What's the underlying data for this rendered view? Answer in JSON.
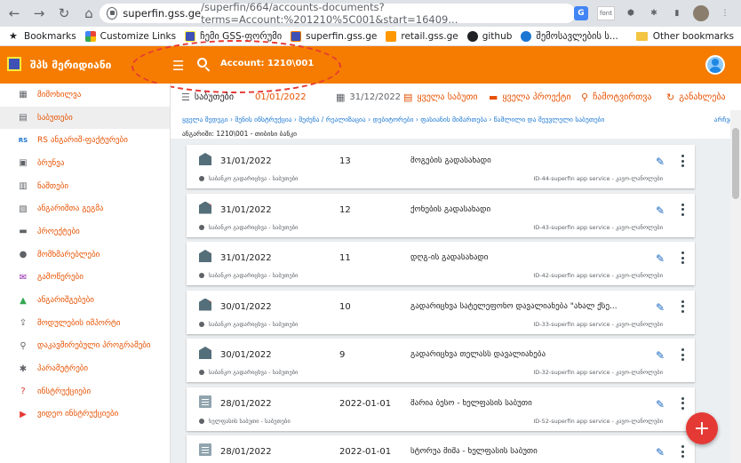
{
  "browser": {
    "url_host": "superfin.gss.ge",
    "url_path": "/superfin/664/accounts-documents?terms=Account:%201210%5C001&start=16409...",
    "ext_font_label": "font",
    "bookmarks": [
      {
        "label": "Bookmarks",
        "icon": "star-icon"
      },
      {
        "label": "Customize Links",
        "icon": "apps-icon"
      },
      {
        "label": "ჩემი GSS-ფორუმი",
        "icon": "gss-icon"
      },
      {
        "label": "superfin.gss.ge",
        "icon": "superfin-icon"
      },
      {
        "label": "retail.gss.ge",
        "icon": "cart-icon"
      },
      {
        "label": "github",
        "icon": "github-icon"
      },
      {
        "label": "შემოსავლების ს...",
        "icon": "revenue-icon"
      }
    ],
    "other_bookmarks": "Other bookmarks"
  },
  "header": {
    "app_name": "შპს მერიდიანი",
    "search_text": "Account: 1210\\001"
  },
  "sidebar": {
    "items": [
      {
        "label": "მიმოხილვა",
        "icon": "grid-icon",
        "active": false
      },
      {
        "label": "საბუთები",
        "icon": "document-icon",
        "active": true
      },
      {
        "label": "RS ანგარიშ-ფაქტურები",
        "icon": "rs-icon",
        "active": false
      },
      {
        "label": "ბრუნვა",
        "icon": "turnover-icon",
        "active": false
      },
      {
        "label": "ნაშთები",
        "icon": "balance-icon",
        "active": false
      },
      {
        "label": "ანგარიშთა გეგმა",
        "icon": "chart-plan-icon",
        "active": false
      },
      {
        "label": "პროექტები",
        "icon": "folder-icon",
        "active": false
      },
      {
        "label": "მომხმარებლები",
        "icon": "users-icon",
        "active": false
      },
      {
        "label": "გამოწერები",
        "icon": "subscription-icon",
        "active": false
      },
      {
        "label": "ანგარიშგებები",
        "icon": "drive-icon",
        "active": false
      },
      {
        "label": "მოდულების იმპორტი",
        "icon": "import-icon",
        "active": false
      },
      {
        "label": "დაკავშირებული პროგრამები",
        "icon": "attach-icon",
        "active": false
      },
      {
        "label": "პარამეტრები",
        "icon": "settings-icon",
        "active": false
      },
      {
        "label": "ინსტრუქციები",
        "icon": "help-icon",
        "active": false
      },
      {
        "label": "ვიდეო ინსტრუქციები",
        "icon": "video-icon",
        "active": false
      }
    ]
  },
  "toolbar": {
    "title": "საბუთები",
    "date_from": "01/01/2022",
    "date_to": "31/12/2022",
    "all_docs": "ყველა საბუთი",
    "all_projects": "ყველა პროექტი",
    "attach": "ჩამოტვირთვა",
    "refresh": "განახლება"
  },
  "breadcrumb": {
    "path": "ყველა შედეგი  ›  მენის ინსტრუქცია  ›  შეძენა / რეალიზაცია  ›  დებიტორები  ›  ფასიანის მიმართება  ›  წამლილი და შეუვლელი საბუთები",
    "end": "არჩვა",
    "subline": "ანგარიში: 1210\\001 - თიბისი ბანკი"
  },
  "documents": [
    {
      "date": "31/01/2022",
      "num": "13",
      "desc": "მოგების გადასახადი",
      "sub": "საბანკო გადარიცხვა - საბუთები",
      "id": "ID-44-superfin app service - კავო-ლანოლები",
      "icon": "bank-icon"
    },
    {
      "date": "31/01/2022",
      "num": "12",
      "desc": "ქონების გადასახადი",
      "sub": "საბანკო გადარიცხვა - საბუთები",
      "id": "ID-43-superfin app service - კავო-ლანოლები",
      "icon": "bank-icon"
    },
    {
      "date": "31/01/2022",
      "num": "11",
      "desc": "დღგ-ის გადასახადი",
      "sub": "საბანკო გადარიცხვა - საბუთები",
      "id": "ID-42-superfin app service - კავო-ლანოლები",
      "icon": "bank-icon"
    },
    {
      "date": "30/01/2022",
      "num": "10",
      "desc": "გადარიცხვა სატელეფონო დავალიანება \"ახალ ქსე...",
      "sub": "საბანკო გადარიცხვა - საბუთები",
      "id": "ID-33-superfin app service - კავო-ლანოლები",
      "icon": "bank-icon"
    },
    {
      "date": "30/01/2022",
      "num": "9",
      "desc": "გადარიცხვა თელასს დავალიანება",
      "sub": "საბანკო გადარიცხვა - საბუთები",
      "id": "ID-32-superfin app service - კავო-ლანოლები",
      "icon": "bank-icon"
    },
    {
      "date": "28/01/2022",
      "num": "2022-01-01",
      "desc": "შარია ბესო - ხელფასის საბუთი",
      "sub": "ხელფასის საბუთი - საბუთები",
      "id": "ID-52-superfin app service - კავო-ლანოლები",
      "icon": "payroll-icon"
    },
    {
      "date": "28/01/2022",
      "num": "2022-01-01",
      "desc": "სტორუა მიშა - ხელფასის საბუთი",
      "sub": "ხელფასის საბუთი - საბუთები",
      "id": "ID-53-superfin app service - კავო-ლანოლები",
      "icon": "payroll-icon"
    }
  ],
  "fab": "+"
}
